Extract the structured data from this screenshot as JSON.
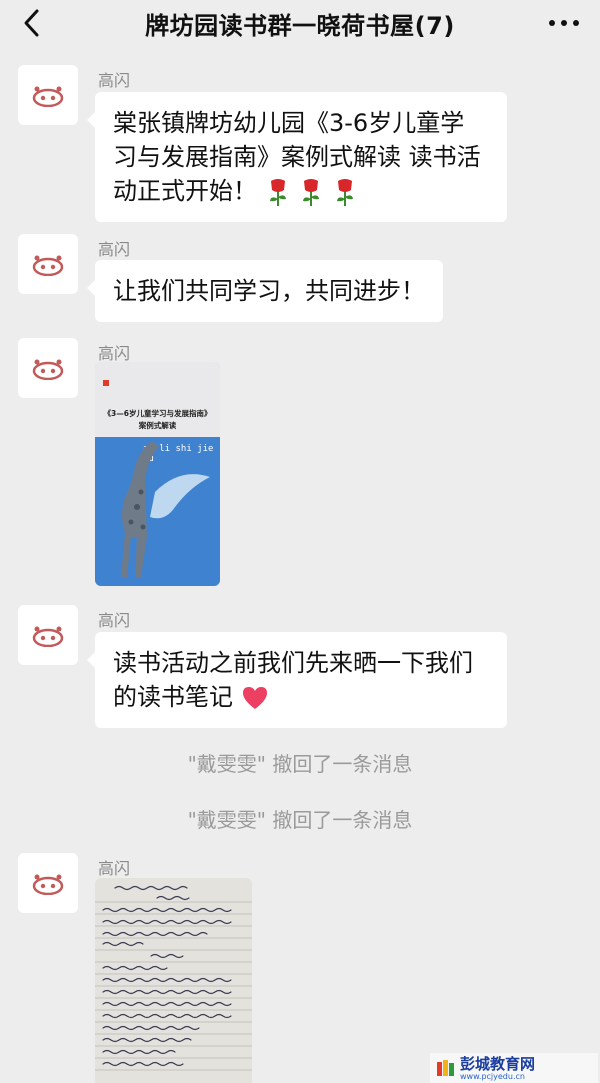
{
  "header": {
    "title": "牌坊园读书群一晓荷书屋(7)",
    "back_icon": "chevron-left-icon",
    "more_icon": "ellipsis-icon"
  },
  "messages": [
    {
      "sender": "高闪",
      "type": "text",
      "lines": [
        "棠张镇牌坊幼儿园《3-6岁儿童学",
        "习与发展指南》案例式解读 读书活",
        "动正式开始！"
      ],
      "emoji": [
        "rose",
        "rose",
        "rose"
      ]
    },
    {
      "sender": "高闪",
      "type": "text",
      "lines": [
        "让我们共同学习，共同进步！"
      ]
    },
    {
      "sender": "高闪",
      "type": "image",
      "book": {
        "title": "《3—6岁儿童学习与发展指南》",
        "subtitle": "案例式解读",
        "pinyin": "an li shi jie du"
      }
    },
    {
      "sender": "高闪",
      "type": "text",
      "lines": [
        "读书活动之前我们先来晒一下我们",
        "的读书笔记"
      ],
      "emoji": [
        "heart"
      ]
    },
    {
      "sender": "高闪",
      "type": "image",
      "description_icon": "handwritten-notes-photo"
    }
  ],
  "system_messages": [
    "\"戴雯雯\" 撤回了一条消息",
    "\"戴雯雯\" 撤回了一条消息"
  ],
  "watermark": {
    "text": "彭城教育网",
    "sub": "www.pcjyedu.cn"
  },
  "colors": {
    "background": "#ededed",
    "bubble": "#ffffff",
    "sender": "#8a8a8a",
    "system": "#9a9a9a",
    "book_blue": "#3f82d0"
  }
}
